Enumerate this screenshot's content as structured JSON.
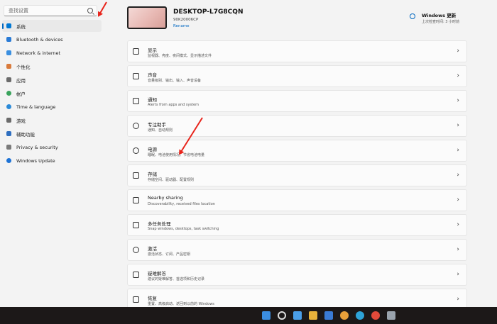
{
  "sidebar": {
    "search_placeholder": "查找设置",
    "items": [
      {
        "label": "系统",
        "color": "#0078d4"
      },
      {
        "label": "Bluetooth & devices",
        "color": "#2a7bd6"
      },
      {
        "label": "Network & internet",
        "color": "#3a8fe0"
      },
      {
        "label": "个性化",
        "color": "#d97b3c"
      },
      {
        "label": "应用",
        "color": "#6b6b6b"
      },
      {
        "label": "帐户",
        "color": "#3aa35c"
      },
      {
        "label": "Time & language",
        "color": "#2b8ad8"
      },
      {
        "label": "游戏",
        "color": "#6b6b6b"
      },
      {
        "label": "辅助功能",
        "color": "#2f6fc0"
      },
      {
        "label": "Privacy & security",
        "color": "#7a7a7a"
      },
      {
        "label": "Windows Update",
        "color": "#1e73d6"
      }
    ]
  },
  "device": {
    "name": "DESKTOP-L7G8CQN",
    "model": "90K20006CP",
    "rename": "Rename"
  },
  "windows_update": {
    "title": "Windows 更新",
    "subtitle": "上次检查时间: 3 小时前"
  },
  "cards": [
    {
      "title": "显示",
      "sub": "监视器、亮度、夜间模式、显示描述文件",
      "icon": "display-icon"
    },
    {
      "title": "声音",
      "sub": "音量级别、输出、输入、声音设备",
      "icon": "sound-icon"
    },
    {
      "title": "通知",
      "sub": "Alerts from apps and system",
      "icon": "notification-icon"
    },
    {
      "title": "专注助手",
      "sub": "通知、自动规则",
      "icon": "focus-assist-icon"
    },
    {
      "title": "电源",
      "sub": "睡眠、电池使用情况、节省电池电量",
      "icon": "power-icon"
    },
    {
      "title": "存储",
      "sub": "存储空间、驱动器、配置规则",
      "icon": "storage-icon"
    },
    {
      "title": "Nearby sharing",
      "sub": "Discoverability, received files location",
      "icon": "nearby-sharing-icon"
    },
    {
      "title": "多任务处理",
      "sub": "Snap windows, desktops, task switching",
      "icon": "multitasking-icon"
    },
    {
      "title": "激活",
      "sub": "激活状态、订阅、产品密钥",
      "icon": "activation-icon"
    },
    {
      "title": "疑难解答",
      "sub": "建议的疑难解答、首选项和历史记录",
      "icon": "troubleshoot-icon"
    },
    {
      "title": "恢复",
      "sub": "重置、高级启动、返回到以前的 Windows",
      "icon": "recovery-icon"
    }
  ],
  "chevron": "›",
  "accent": "#0067c0",
  "annotation_color": "#e8241b"
}
